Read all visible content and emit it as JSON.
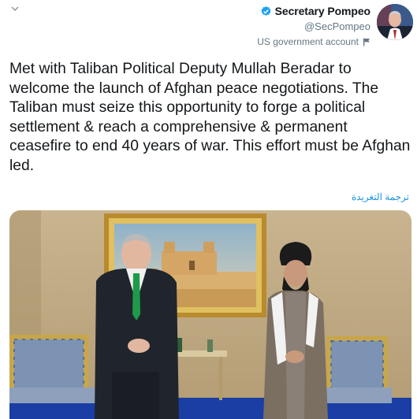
{
  "header": {
    "display_name": "Secretary Pompeo",
    "handle": "@SecPompeo",
    "account_label": "US government account"
  },
  "tweet": {
    "text": "Met with Taliban Political Deputy Mullah Beradar to welcome the launch of Afghan peace negotiations. The Taliban must seize this opportunity to forge a political settlement & reach a comprehensive & permanent ceasefire to end 40 years of war. This effort must be Afghan led.",
    "translate_label": "ترجمة التغريدة"
  },
  "icons": {
    "menu": "chevron-down-icon",
    "verified": "verified-badge-icon",
    "label": "flag-icon"
  },
  "colors": {
    "link": "#1b95e0",
    "verified": "#1da1f2",
    "secondary_text": "#657786"
  }
}
